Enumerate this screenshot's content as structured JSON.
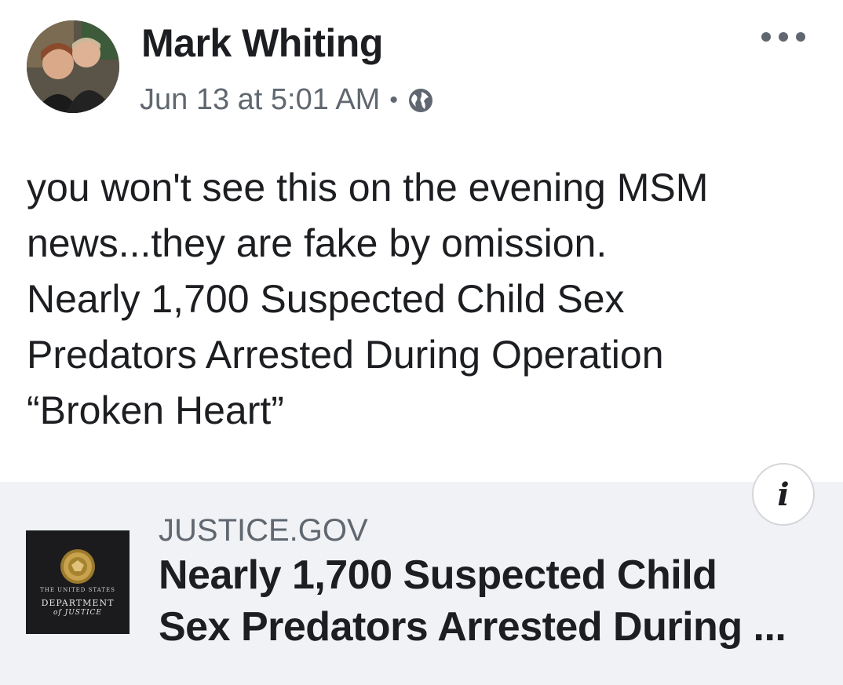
{
  "post": {
    "author": "Mark Whiting",
    "date": "Jun 13 at 5:01 AM",
    "separator": "•",
    "privacy_icon": "globe-icon",
    "more_icon": "more-options-icon",
    "text_lines": [
      "you won't see this on the evening MSM",
      "news...they are fake by omission.",
      "Nearly 1,700 Suspected Child Sex",
      "Predators Arrested During Operation",
      "“Broken Heart”"
    ]
  },
  "link_card": {
    "domain": "JUSTICE.GOV",
    "headline_lines": [
      "Nearly 1,700 Suspected Child",
      "Sex Predators Arrested During ..."
    ],
    "info_label": "i",
    "logo": {
      "line1": "THE UNITED STATES",
      "line2": "DEPARTMENT",
      "line3": "of JUSTICE"
    }
  },
  "colors": {
    "text_primary": "#1c1e21",
    "text_secondary": "#606770",
    "card_background": "#f0f2f5",
    "logo_background": "#1b1b1d",
    "seal_gold": "#b8953f"
  }
}
